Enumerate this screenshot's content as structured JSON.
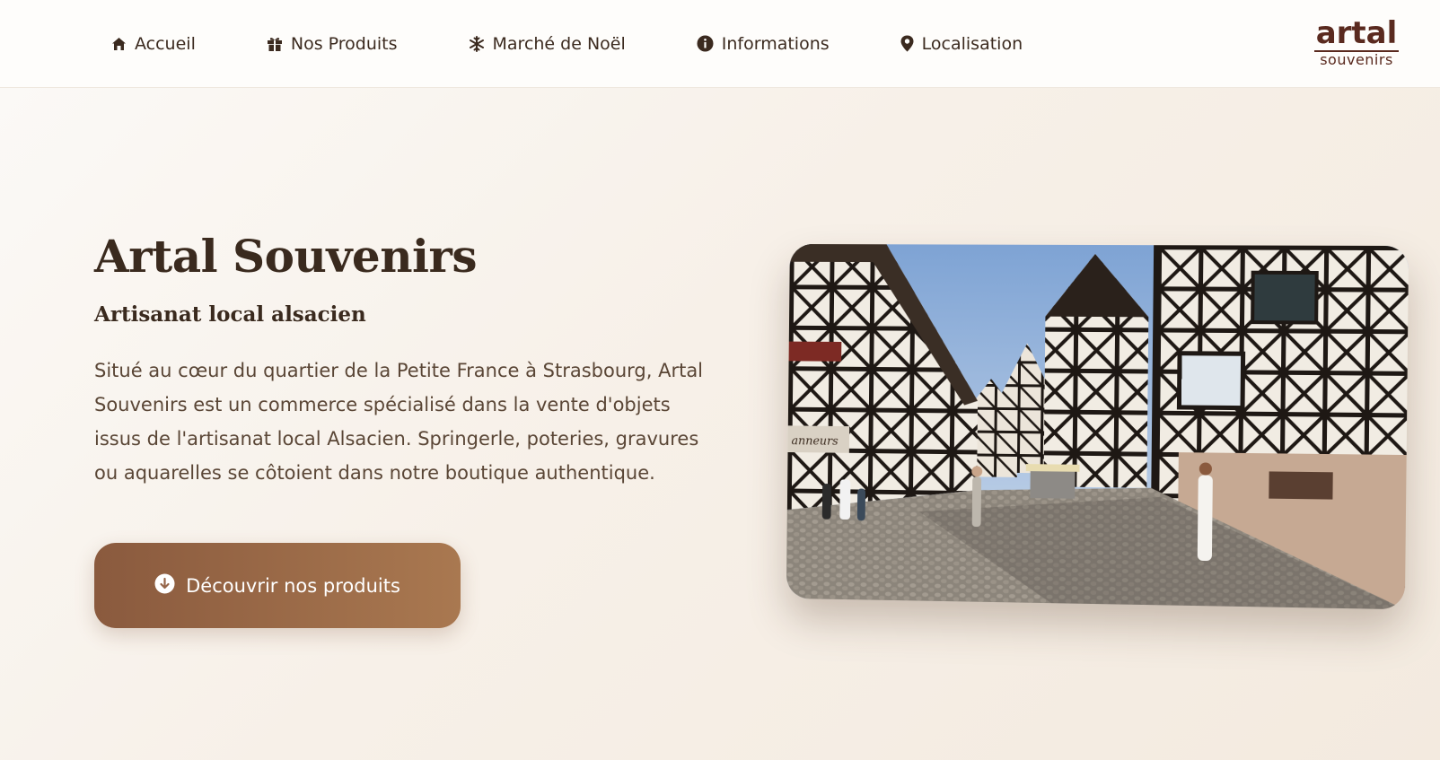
{
  "nav": {
    "items": [
      {
        "label": "Accueil",
        "icon": "home-icon"
      },
      {
        "label": "Nos Produits",
        "icon": "gift-icon"
      },
      {
        "label": "Marché de Noël",
        "icon": "snowflake-icon"
      },
      {
        "label": "Informations",
        "icon": "info-circle-icon"
      },
      {
        "label": "Localisation",
        "icon": "map-pin-icon"
      }
    ],
    "logo": {
      "top": "artal",
      "bottom": "souvenirs"
    }
  },
  "hero": {
    "title": "Artal Souvenirs",
    "subtitle": "Artisanat local alsacien",
    "description": "Situé au cœur du quartier de la Petite France à Strasbourg, Artal Souvenirs est un commerce spécialisé dans la vente d'objets issus de l'artisanat local Alsacien. Springerle, poteries, gravures ou aquarelles se côtoient dans notre boutique authentique.",
    "cta": {
      "label": "Découvrir nos produits",
      "icon": "arrow-down-circle-icon"
    },
    "image": {
      "sign_text": "anneurs"
    }
  },
  "colors": {
    "text_dark": "#3a2a1e",
    "body_text": "#5a4636",
    "accent_start": "#8a5a3e",
    "accent_end": "#a97850",
    "logo": "#5a2a1f",
    "hero_bg": "#f7f0e8"
  }
}
